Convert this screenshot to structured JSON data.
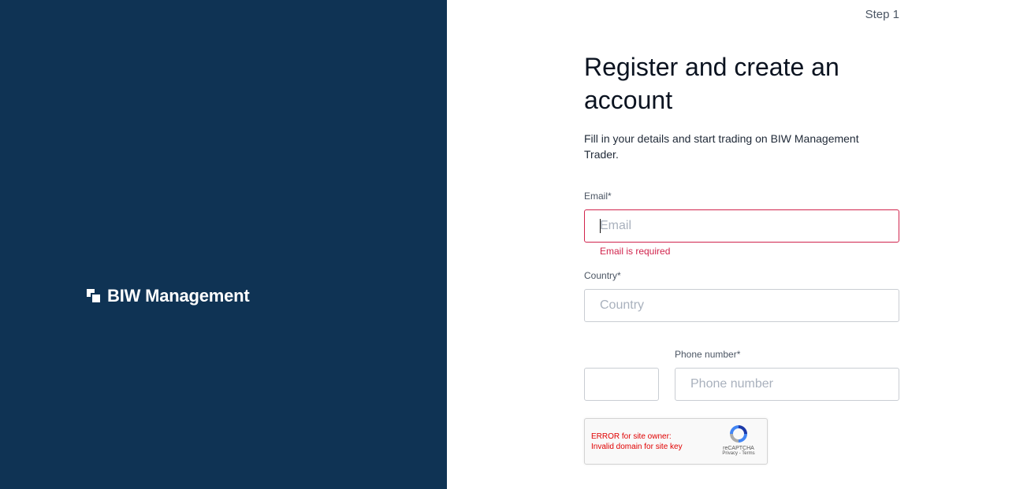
{
  "brand": {
    "name": "BIW Management"
  },
  "header": {
    "step": "Step 1"
  },
  "form": {
    "title": "Register and create an account",
    "subtitle": "Fill in your details and start trading on BIW Management Trader.",
    "email": {
      "label": "Email",
      "required_mark": "*",
      "placeholder": "Email",
      "value": "",
      "error": "Email is required"
    },
    "country": {
      "label": "Country",
      "required_mark": "*",
      "placeholder": "Country",
      "value": ""
    },
    "phone": {
      "label": "Phone number",
      "required_mark": "*",
      "placeholder": "Phone number",
      "value": "",
      "code_value": ""
    }
  },
  "recaptcha": {
    "error_line1": "ERROR for site owner:",
    "error_line2": "Invalid domain for site key",
    "name": "reCAPTCHA",
    "links": "Privacy - Terms"
  },
  "colors": {
    "sidebar_bg": "#0f3354",
    "error": "#d1244d",
    "recaptcha_error": "#e00000"
  }
}
